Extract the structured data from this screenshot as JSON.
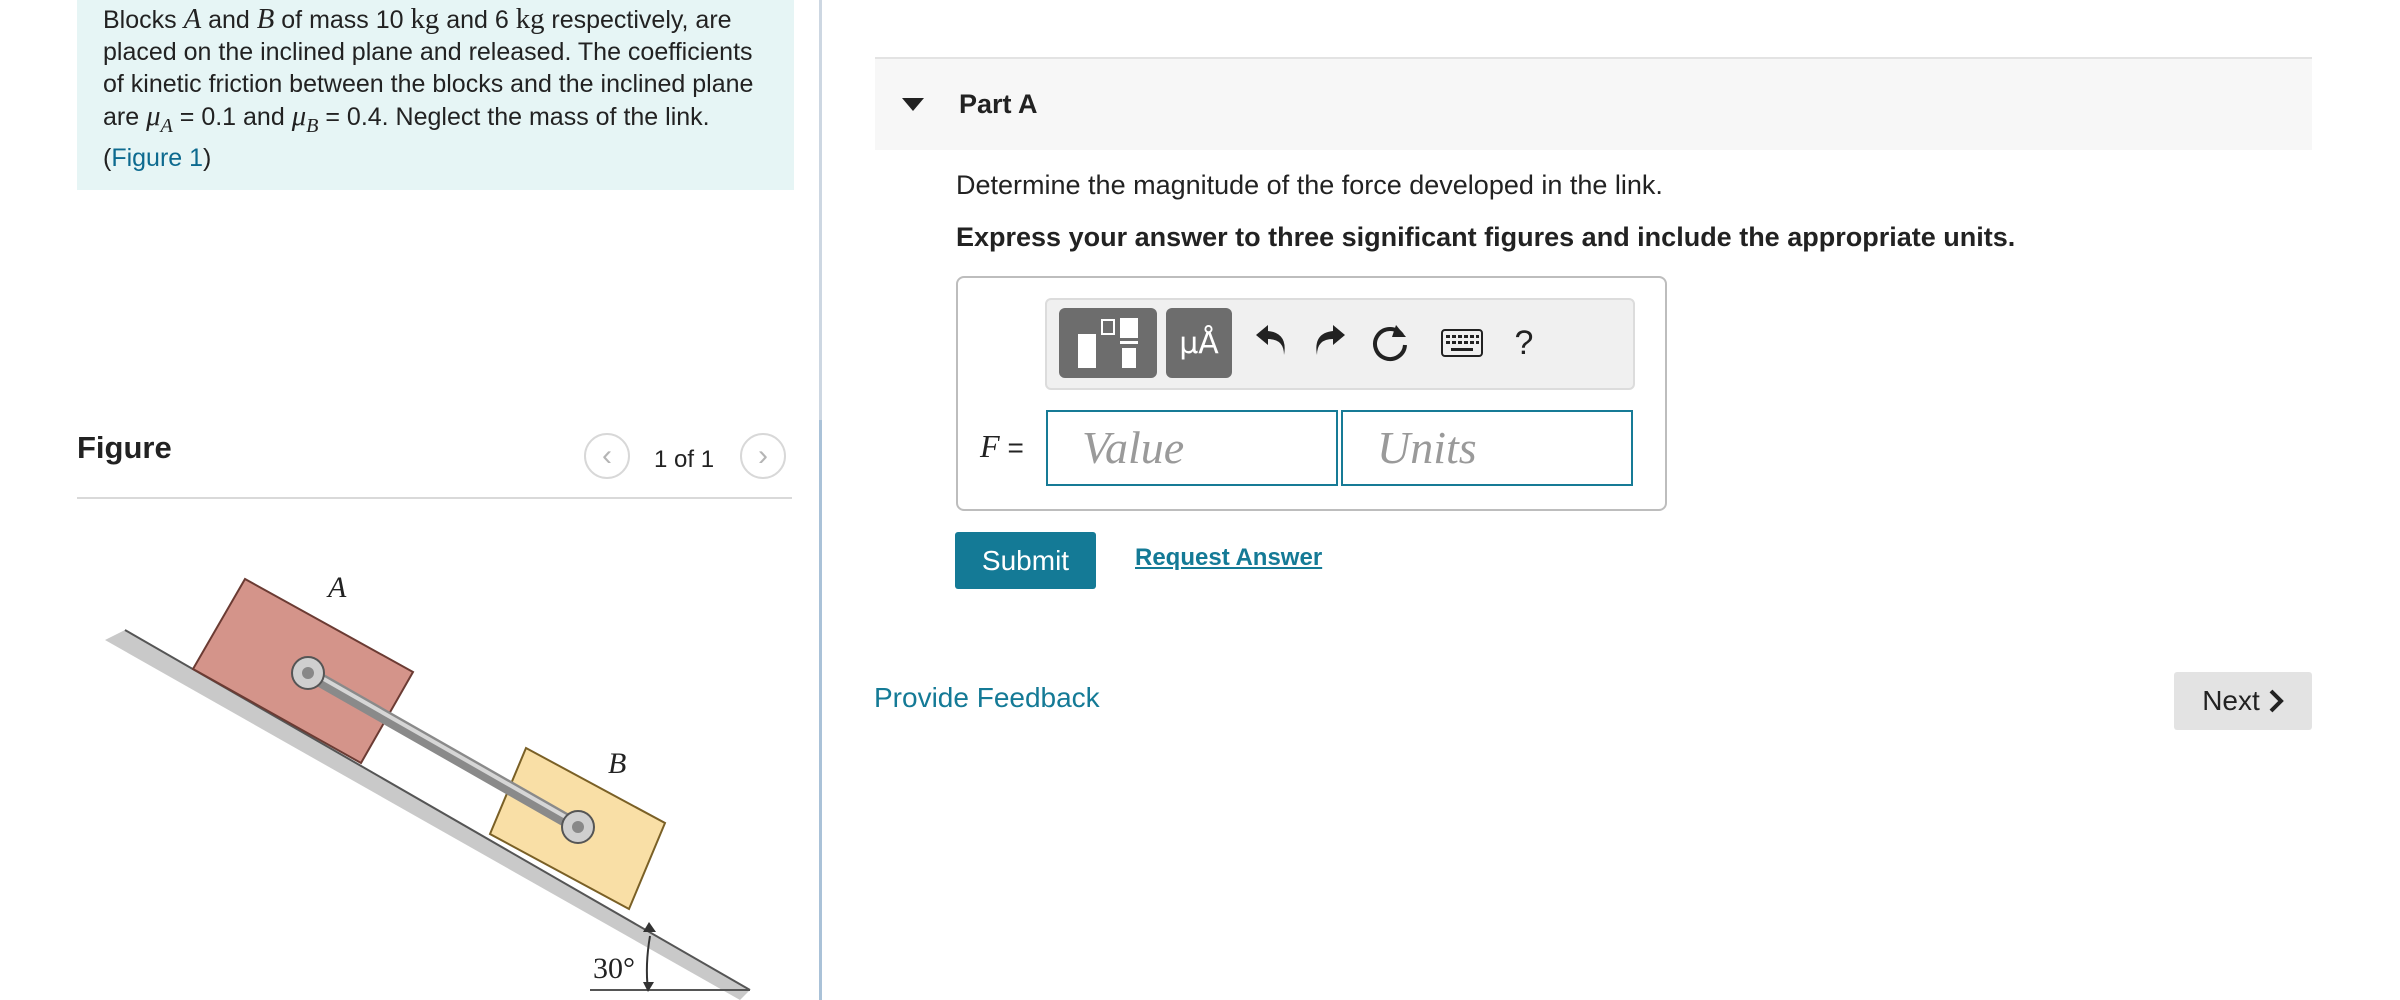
{
  "problem": {
    "text_1": "Blocks ",
    "var_a": "A",
    "text_2": " and ",
    "var_b": "B",
    "text_3": " of mass 10 ",
    "unit_kg_1": "kg",
    "text_4": " and 6 ",
    "unit_kg_2": "kg",
    "text_5": " respectively, are placed on the inclined plane and released. The coefficients of kinetic friction between the blocks and the inclined plane are ",
    "mu_a": "μ",
    "mu_a_sub": "A",
    "text_6": " = 0.1 and ",
    "mu_b": "μ",
    "mu_b_sub": "B",
    "text_7": " = 0.4. Neglect the mass of the link. (",
    "figure_link": "Figure 1",
    "text_8": ")"
  },
  "figure": {
    "heading": "Figure",
    "pager": "1 of 1",
    "prev_icon": "chevron-left-icon",
    "next_icon": "chevron-right-icon",
    "label_a": "A",
    "label_b": "B",
    "angle_label": "30°",
    "colors": {
      "block_a": "#d4948a",
      "block_b": "#f9dfa6",
      "incline": "#c9c9c9"
    }
  },
  "part": {
    "title": "Part A",
    "question": "Determine the magnitude of the force developed in the link.",
    "instruction": "Express your answer to three significant figures and include the appropriate units."
  },
  "toolbar": {
    "templates_icon": "templates-icon",
    "units_label": "μÅ",
    "undo_icon": "undo-icon",
    "redo_icon": "redo-icon",
    "reset_icon": "reset-icon",
    "keyboard_icon": "keyboard-icon",
    "help_label": "?"
  },
  "answer": {
    "var_label": "F",
    "equals": " =",
    "value_placeholder": "Value",
    "units_placeholder": "Units"
  },
  "actions": {
    "submit": "Submit",
    "request_answer": "Request Answer",
    "provide_feedback": "Provide Feedback",
    "next": "Next"
  },
  "colors": {
    "accent": "#147a96",
    "problem_bg": "#e6f5f5"
  }
}
